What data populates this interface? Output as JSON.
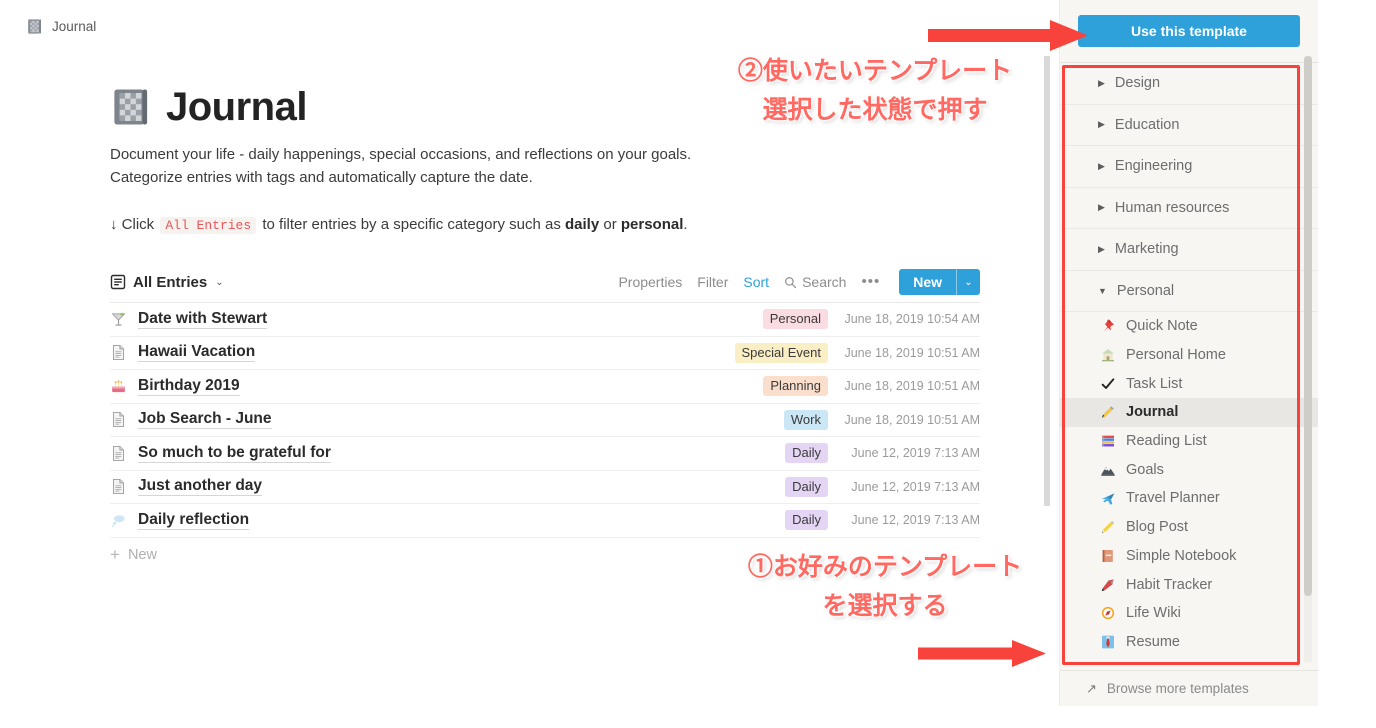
{
  "breadcrumb": {
    "label": "Journal",
    "icon": "notebook-icon"
  },
  "document": {
    "emoji": "notebook-emoji",
    "title": "Journal",
    "description": "Document your life - daily happenings, special occasions, and reflections on your goals. Categorize entries with tags and automatically capture the date.",
    "hint": {
      "prefix": "↓ Click",
      "code": "All Entries",
      "middle": "to filter entries by a specific category such as",
      "bold1": "daily",
      "conj": "or",
      "bold2": "personal",
      "suffix": "."
    }
  },
  "database": {
    "view_name": "All Entries",
    "view_icon": "list-view-icon",
    "view_caret": "⌄",
    "controls": {
      "properties": "Properties",
      "filter": "Filter",
      "sort": "Sort",
      "search": "Search",
      "more": "•••",
      "new": "New",
      "new_caret": "⌄"
    },
    "accent_color": "#2ea1db",
    "rows": [
      {
        "icon": "cocktail-glass-icon",
        "title": "Date with Stewart",
        "tag": "Personal",
        "tag_color": "#fbdce2",
        "date": "June 18, 2019 10:54 AM"
      },
      {
        "icon": "page-icon",
        "title": "Hawaii Vacation",
        "tag": "Special Event",
        "tag_color": "#faeec5",
        "date": "June 18, 2019 10:51 AM"
      },
      {
        "icon": "birthday-cake-icon",
        "title": "Birthday 2019",
        "tag": "Planning",
        "tag_color": "#fbdfcd",
        "date": "June 18, 2019 10:51 AM"
      },
      {
        "icon": "page-icon",
        "title": "Job Search - June",
        "tag": "Work",
        "tag_color": "#cbe6f5",
        "date": "June 18, 2019 10:51 AM"
      },
      {
        "icon": "page-icon",
        "title": "So much to be grateful for",
        "tag": "Daily",
        "tag_color": "#e5d5f5",
        "date": "June 12, 2019 7:13 AM"
      },
      {
        "icon": "page-icon",
        "title": "Just another day",
        "tag": "Daily",
        "tag_color": "#e5d5f5",
        "date": "June 12, 2019 7:13 AM"
      },
      {
        "icon": "thought-balloon-icon",
        "title": "Daily reflection",
        "tag": "Daily",
        "tag_color": "#e5d5f5",
        "date": "June 12, 2019 7:13 AM"
      }
    ],
    "new_row_label": "New"
  },
  "template_panel": {
    "use_template_button": "Use this template",
    "categories": [
      {
        "label": "Design",
        "expanded": false
      },
      {
        "label": "Education",
        "expanded": false
      },
      {
        "label": "Engineering",
        "expanded": false
      },
      {
        "label": "Human resources",
        "expanded": false
      },
      {
        "label": "Marketing",
        "expanded": false
      },
      {
        "label": "Personal",
        "expanded": true
      }
    ],
    "personal_templates": [
      {
        "label": "Quick Note",
        "emoji": "pushpin-icon",
        "selected": false
      },
      {
        "label": "Personal Home",
        "emoji": "house-icon",
        "selected": false
      },
      {
        "label": "Task List",
        "emoji": "check-mark-icon",
        "selected": false
      },
      {
        "label": "Journal",
        "emoji": "pen-icon",
        "selected": true
      },
      {
        "label": "Reading List",
        "emoji": "books-icon",
        "selected": false
      },
      {
        "label": "Goals",
        "emoji": "mountain-icon",
        "selected": false
      },
      {
        "label": "Travel Planner",
        "emoji": "airplane-icon",
        "selected": false
      },
      {
        "label": "Blog Post",
        "emoji": "pencil-icon",
        "selected": false
      },
      {
        "label": "Simple Notebook",
        "emoji": "notebook-icon",
        "selected": false
      },
      {
        "label": "Habit Tracker",
        "emoji": "dart-pen-icon",
        "selected": false
      },
      {
        "label": "Life Wiki",
        "emoji": "compass-icon",
        "selected": false
      },
      {
        "label": "Resume",
        "emoji": "necktie-icon",
        "selected": false
      }
    ],
    "browse_more": "Browse more templates",
    "browse_icon": "arrow-up-right-icon",
    "highlight_color": "#f8423c",
    "collapse_triangle": "▶",
    "expand_triangle": "▼"
  },
  "annotations": {
    "step2": "②使いたいテンプレート\n選択した状態で押す",
    "step1": "①お好みのテンプレート\nを選択する",
    "color": "#ff6961"
  }
}
